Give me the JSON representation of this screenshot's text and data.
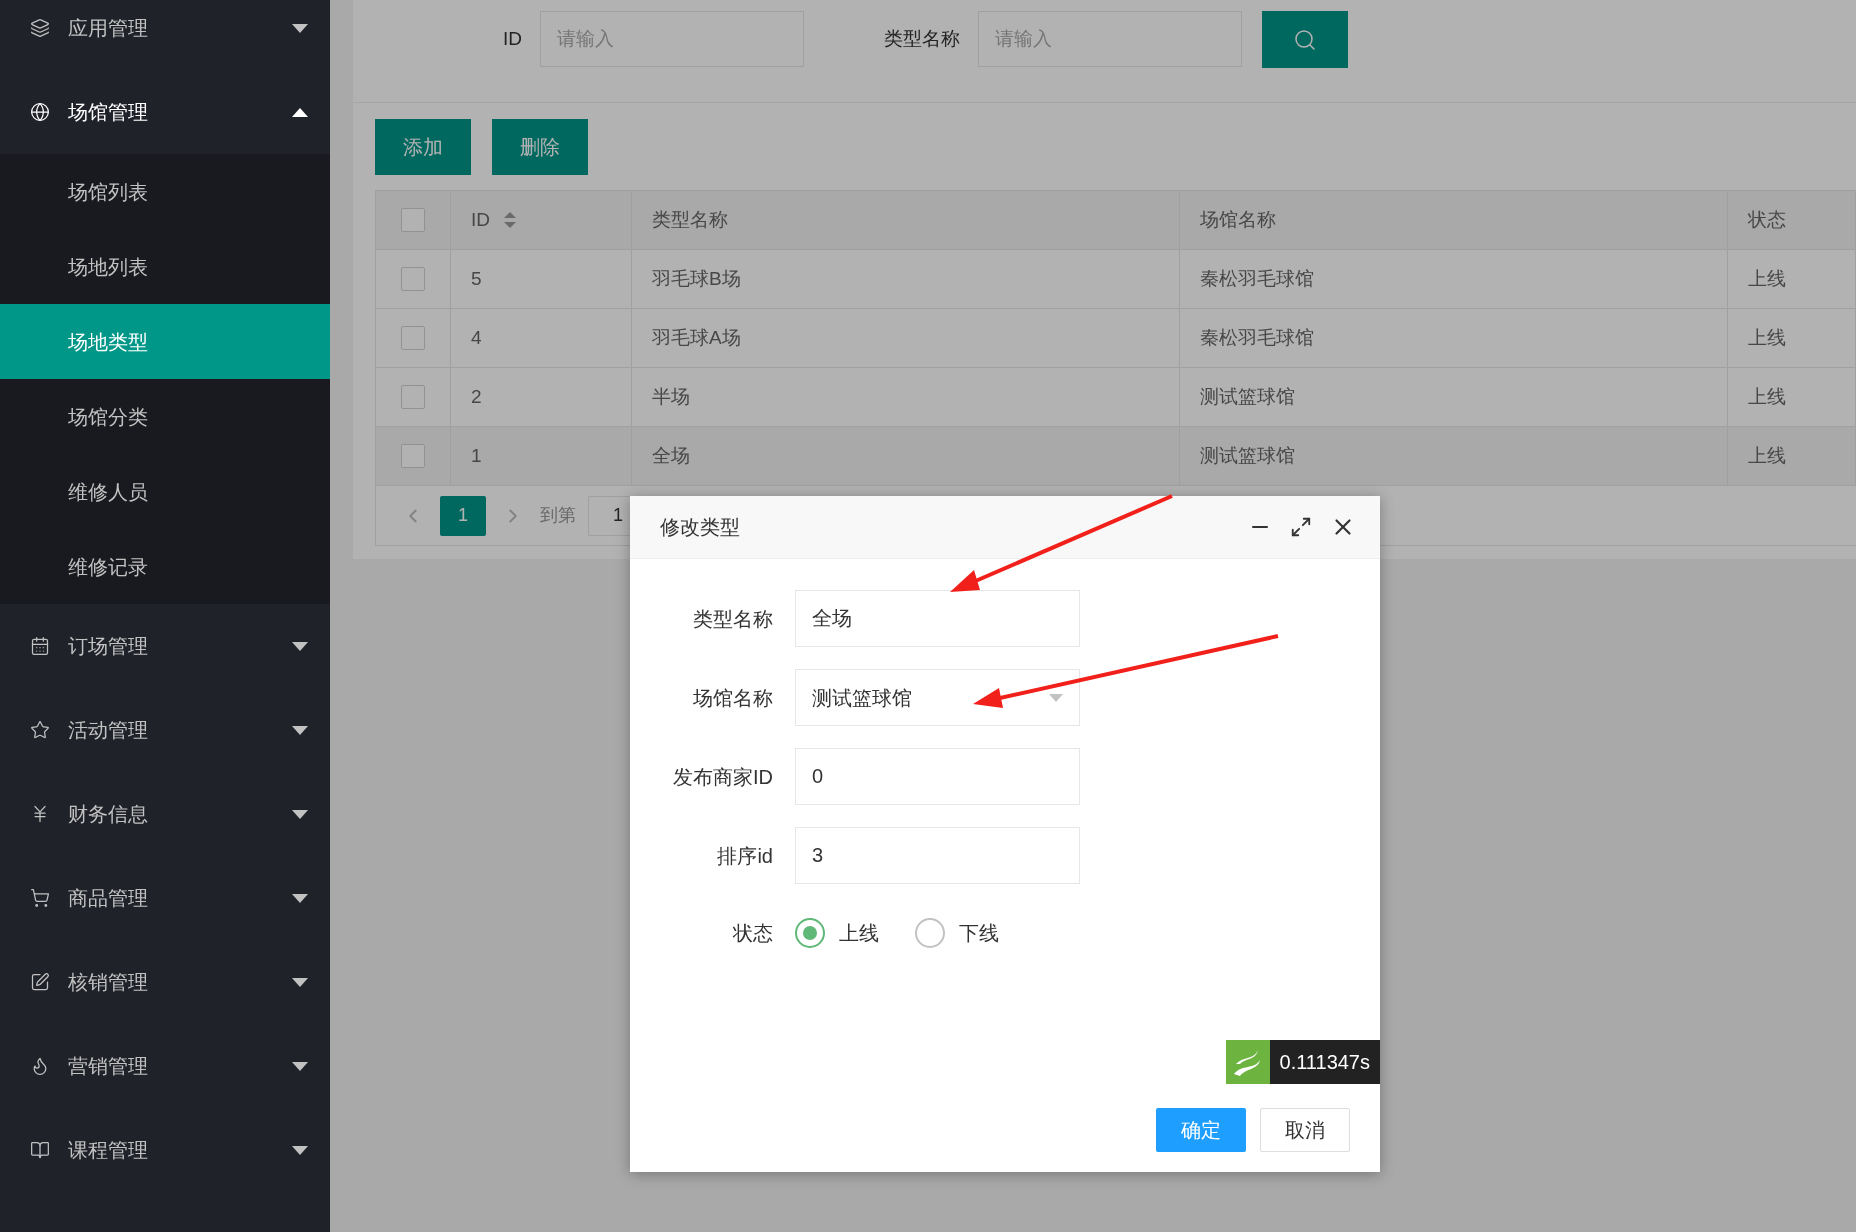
{
  "sidebar": {
    "items": [
      {
        "label": "应用管理",
        "expanded": false
      },
      {
        "label": "场馆管理",
        "expanded": true,
        "children": [
          {
            "label": "场馆列表",
            "selected": false
          },
          {
            "label": "场地列表",
            "selected": false
          },
          {
            "label": "场地类型",
            "selected": true
          },
          {
            "label": "场馆分类",
            "selected": false
          },
          {
            "label": "维修人员",
            "selected": false
          },
          {
            "label": "维修记录",
            "selected": false
          }
        ]
      },
      {
        "label": "订场管理",
        "expanded": false
      },
      {
        "label": "活动管理",
        "expanded": false
      },
      {
        "label": "财务信息",
        "expanded": false
      },
      {
        "label": "商品管理",
        "expanded": false
      },
      {
        "label": "核销管理",
        "expanded": false
      },
      {
        "label": "营销管理",
        "expanded": false
      },
      {
        "label": "课程管理",
        "expanded": false
      }
    ]
  },
  "search": {
    "fields": [
      {
        "label": "ID",
        "placeholder": "请输入"
      },
      {
        "label": "类型名称",
        "placeholder": "请输入"
      }
    ]
  },
  "toolbar": {
    "buttons": [
      "添加",
      "删除"
    ]
  },
  "table": {
    "header_checked": false,
    "columns": [
      "ID",
      "类型名称",
      "场馆名称",
      "状态"
    ],
    "rows": [
      {
        "checked": false,
        "cells": [
          "5",
          "羽毛球B场",
          "秦松羽毛球馆",
          "上线"
        ]
      },
      {
        "checked": false,
        "cells": [
          "4",
          "羽毛球A场",
          "秦松羽毛球馆",
          "上线"
        ]
      },
      {
        "checked": false,
        "cells": [
          "2",
          "半场",
          "测试篮球馆",
          "上线"
        ]
      },
      {
        "checked": false,
        "cells": [
          "1",
          "全场",
          "测试篮球馆",
          "上线"
        ]
      }
    ]
  },
  "pagination": {
    "pages": [
      {
        "label": "1",
        "selected": true
      }
    ],
    "goto_label": "到第",
    "goto_value": "1"
  },
  "dialog": {
    "title": "修改类型",
    "fields": [
      {
        "kind": "text",
        "label": "类型名称",
        "value": "全场"
      },
      {
        "kind": "select",
        "label": "场馆名称",
        "value": "测试篮球馆"
      },
      {
        "kind": "text",
        "label": "发布商家ID",
        "value": "0"
      },
      {
        "kind": "text",
        "label": "排序id",
        "value": "3"
      }
    ],
    "status": {
      "label": "状态",
      "options": [
        {
          "label": "上线",
          "selected": true
        },
        {
          "label": "下线",
          "selected": false
        }
      ]
    },
    "timer": "0.111347s",
    "buttons": [
      {
        "kind": "primary",
        "label": "确定"
      },
      {
        "kind": "default",
        "label": "取消"
      }
    ]
  }
}
